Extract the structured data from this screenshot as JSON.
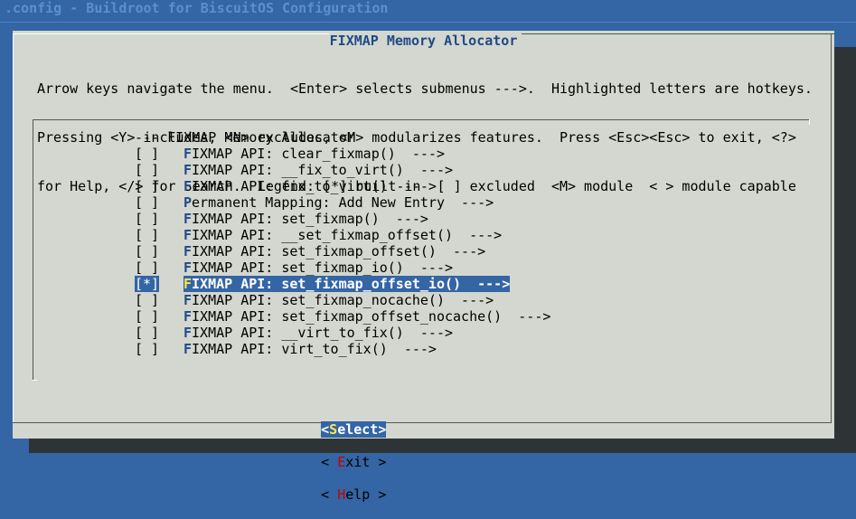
{
  "window": {
    "title": ".config - Buildroot for BiscuitOS Configuration"
  },
  "dialog": {
    "title": "FIXMAP Memory Allocator",
    "help_lines": [
      "Arrow keys navigate the menu.  <Enter> selects submenus --->.  Highlighted letters are hotkeys.",
      "Pressing <Y> includes, <N> excludes, <M> modularizes features.  Press <Esc><Esc> to exit, <?>",
      "for Help, </> for Search.  Legend: [*] built-in  [ ] excluded  <M> module  < > module capable"
    ]
  },
  "menu": {
    "header": "--- FIXMAP Memory Allocator",
    "items": [
      {
        "box": "[ ]",
        "hotkey": "F",
        "rest": "IXMAP API: clear_fixmap()  --->"
      },
      {
        "box": "[ ]",
        "hotkey": "F",
        "rest": "IXMAP API: __fix_to_virt()  --->"
      },
      {
        "box": "[ ]",
        "hotkey": "F",
        "rest": "IXMAP API: fix_to_virt()  --->"
      },
      {
        "box": "[ ]",
        "hotkey": "P",
        "rest": "ermanent Mapping: Add New Entry  --->"
      },
      {
        "box": "[ ]",
        "hotkey": "F",
        "rest": "IXMAP API: set_fixmap()  --->"
      },
      {
        "box": "[ ]",
        "hotkey": "F",
        "rest": "IXMAP API: __set_fixmap_offset()  --->"
      },
      {
        "box": "[ ]",
        "hotkey": "F",
        "rest": "IXMAP API: set_fixmap_offset()  --->"
      },
      {
        "box": "[ ]",
        "hotkey": "F",
        "rest": "IXMAP API: set_fixmap_io()  --->"
      },
      {
        "box": "[*]",
        "hotkey": "F",
        "rest": "IXMAP API: set_fixmap_offset_io()  --->"
      },
      {
        "box": "[ ]",
        "hotkey": "F",
        "rest": "IXMAP API: set_fixmap_nocache()  --->"
      },
      {
        "box": "[ ]",
        "hotkey": "F",
        "rest": "IXMAP API: set_fixmap_offset_nocache()  --->"
      },
      {
        "box": "[ ]",
        "hotkey": "F",
        "rest": "IXMAP API: __virt_to_fix()  --->"
      },
      {
        "box": "[ ]",
        "hotkey": "F",
        "rest": "IXMAP API: virt_to_fix()  --->"
      }
    ],
    "selected_index": 8
  },
  "buttons": {
    "select": {
      "open": "<",
      "hotkey": "S",
      "rest": "elect",
      "close": ">"
    },
    "exit": {
      "open": "< ",
      "hotkey": "E",
      "rest": "xit",
      "close": " >"
    },
    "help": {
      "open": "< ",
      "hotkey": "H",
      "rest": "elp",
      "close": " >"
    }
  },
  "colors": {
    "background": "#3465a4",
    "dialog": "#d3d7cf",
    "highlight": "#3465a4",
    "hotkey": "#204a87",
    "button_hotkey": "#cc0000"
  }
}
